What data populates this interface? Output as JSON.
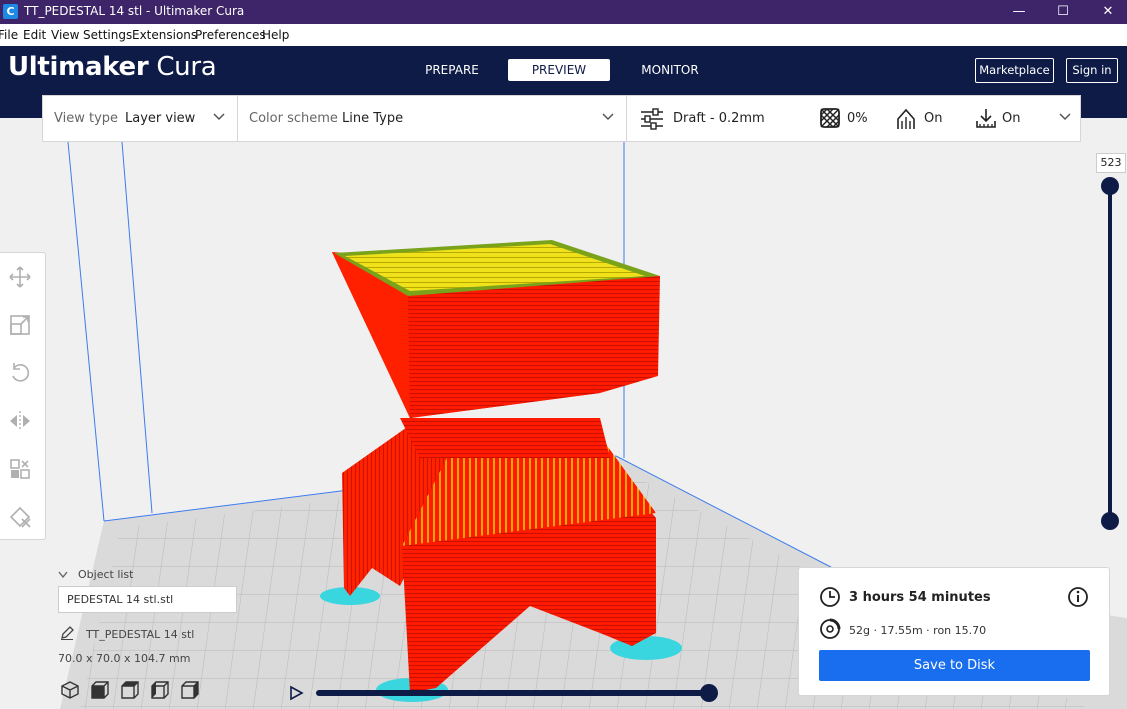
{
  "window": {
    "title": "TT_PEDESTAL 14 stl - Ultimaker Cura",
    "minimize": "—",
    "maximize": "☐",
    "close": "✕"
  },
  "menu": [
    "File",
    "Edit",
    "View",
    "Settings",
    "Extensions",
    "Preferences",
    "Help"
  ],
  "header": {
    "logo_bold": "Ultimaker",
    "logo_light": "Cura",
    "stages": [
      "PREPARE",
      "PREVIEW",
      "MONITOR"
    ],
    "active_stage": "PREVIEW",
    "marketplace": "Marketplace",
    "signin": "Sign in"
  },
  "toolbar": {
    "view_type_label": "View type",
    "view_type_value": "Layer view",
    "color_scheme_label": "Color scheme",
    "color_scheme_value": "Line Type",
    "profile": "Draft - 0.2mm",
    "infill": "0%",
    "support": "On",
    "adhesion": "On"
  },
  "layer_slider": {
    "current_layer": "523"
  },
  "object_list": {
    "header": "Object list",
    "selected_file": "PEDESTAL 14 stl.stl",
    "object_name": "TT_PEDESTAL 14 stl",
    "dimensions": "70.0 x 70.0 x 104.7 mm"
  },
  "print_info": {
    "time": "3 hours 54 minutes",
    "material": "52g · 17.55m · ron 15.70",
    "save_button": "Save to Disk"
  },
  "colors": {
    "titlebar": "#3e2569",
    "header": "#0e1b47",
    "accent": "#196ef0",
    "model_wall": "#ff1a00",
    "model_top": "#f0e21a",
    "support": "#3ad6e0"
  },
  "icons": {
    "app": "cura-app-icon",
    "profile": "sliders-icon",
    "infill": "infill-icon",
    "support": "support-icon",
    "adhesion": "adhesion-icon",
    "time": "clock-icon",
    "material": "spool-icon",
    "info": "info-icon"
  }
}
